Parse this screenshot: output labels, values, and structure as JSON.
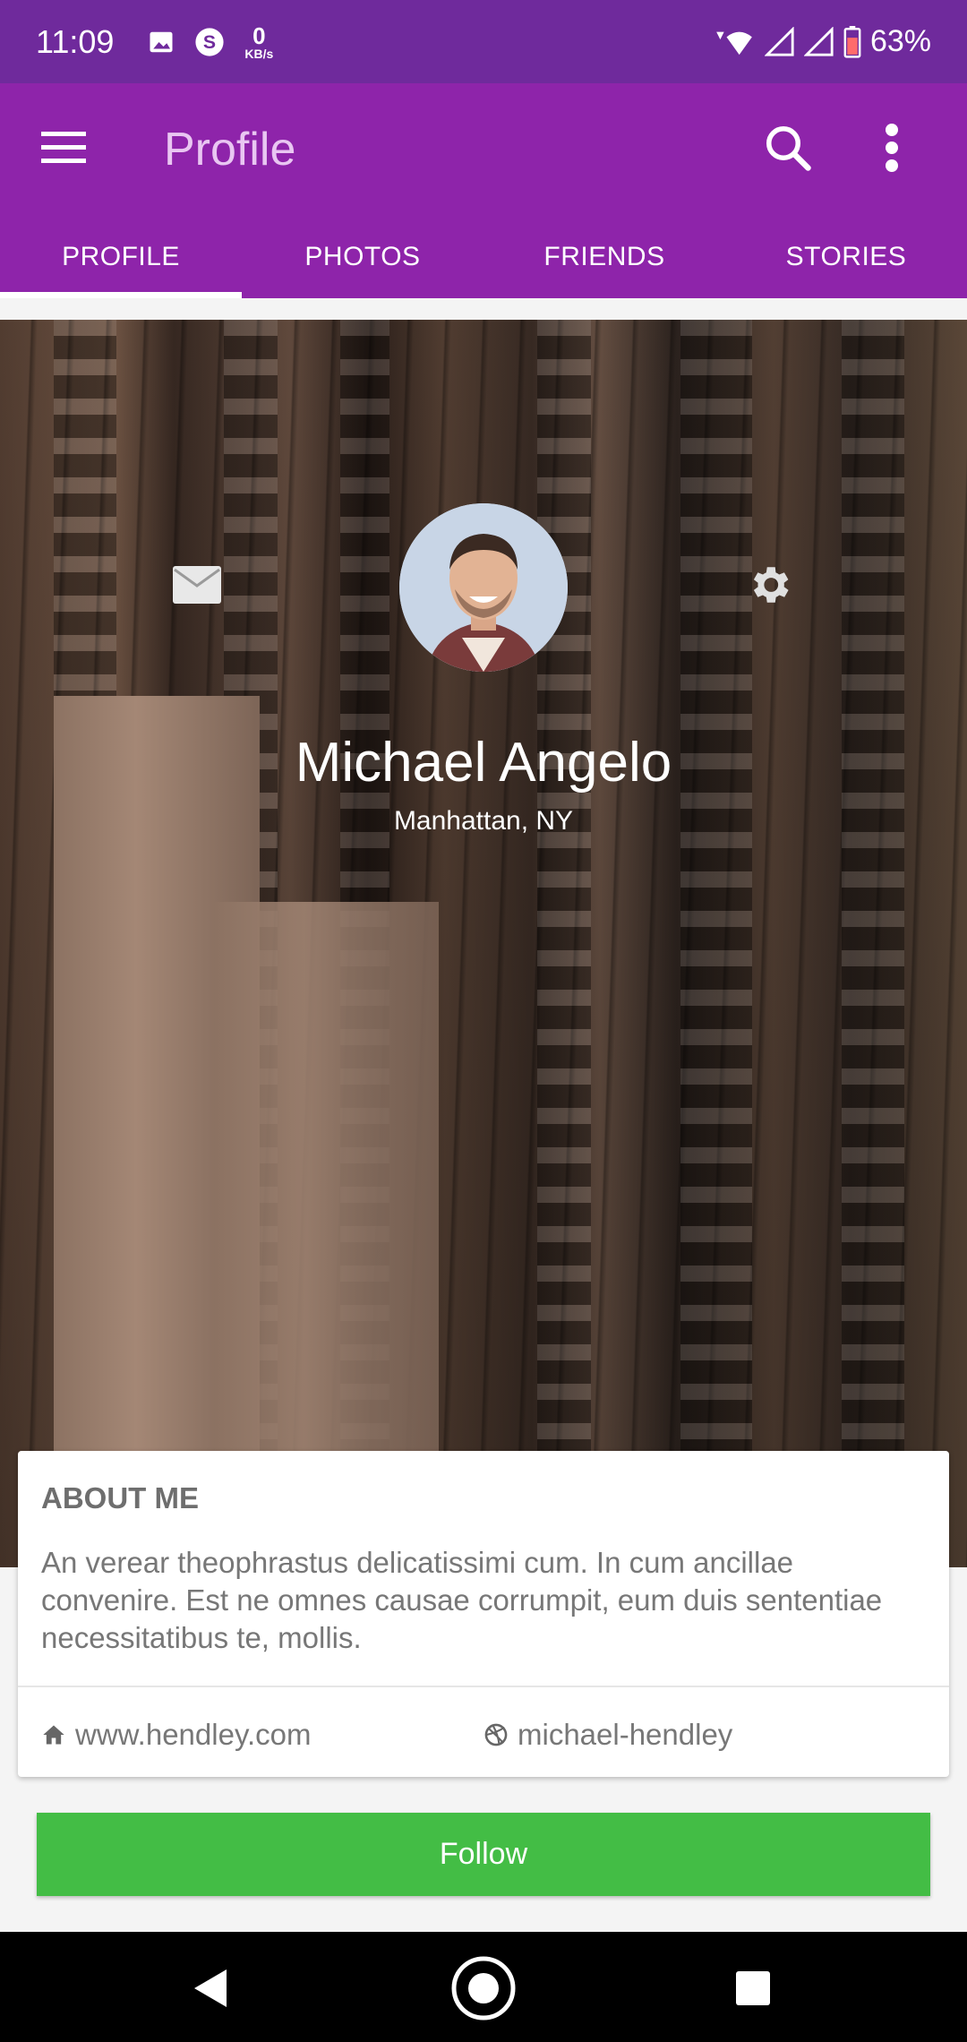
{
  "status_bar": {
    "time": "11:09",
    "net_speed_value": "0",
    "net_speed_unit": "KB/s",
    "battery": "63%",
    "icons": [
      "image-icon",
      "skype-icon",
      "wifi-icon",
      "signal-icon",
      "battery-icon"
    ]
  },
  "toolbar": {
    "title": "Profile",
    "menu_icon": "hamburger-icon",
    "search_icon": "search-icon",
    "overflow_icon": "more-vert-icon"
  },
  "tabs": [
    {
      "label": "PROFILE",
      "active": true
    },
    {
      "label": "PHOTOS",
      "active": false
    },
    {
      "label": "FRIENDS",
      "active": false
    },
    {
      "label": "STORIES",
      "active": false
    }
  ],
  "profile": {
    "name": "Michael Angelo",
    "location": "Manhattan, NY"
  },
  "about": {
    "title": "ABOUT ME",
    "text": "An verear theophrastus delicatissimi cum. In cum ancillae convenire. Est ne omnes causae corrumpit, eum duis sententiae necessitatibus te, mollis.",
    "website": "www.hendley.com",
    "dribbble": "michael-hendley"
  },
  "follow_label": "Follow",
  "colors": {
    "status_bar": "#6f2a9c",
    "app_bar": "#8e24aa",
    "follow": "#43bd45"
  }
}
